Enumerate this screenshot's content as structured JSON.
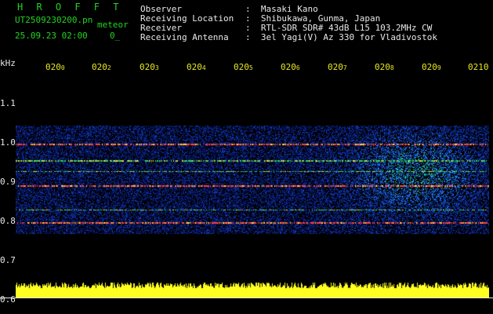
{
  "header": {
    "brand": "H R O F F T",
    "filename": "UT2509230200.pn",
    "mode": "meteor",
    "datetime": "25.09.23 02:00",
    "counter": "0_",
    "info": [
      {
        "label": "Observer",
        "value": ":  Masaki Kano"
      },
      {
        "label": "Receiving Location",
        "value": ":  Shibukawa, Gunma, Japan"
      },
      {
        "label": "Receiver",
        "value": ":  RTL-SDR SDR# 43dB L15 103.2MHz CW"
      },
      {
        "label": "Receiving Antenna",
        "value": ":  3el Yagi(V) Az 330 for Vladivostok"
      }
    ]
  },
  "axis": {
    "y_unit": "kHz",
    "y_ticks": [
      "1.1",
      "1.0",
      "0.9",
      "0.8",
      "0.7",
      "0.6"
    ],
    "x_ticks": [
      "020",
      "020",
      "020",
      "020",
      "020",
      "020",
      "020",
      "020",
      "020",
      "0210"
    ],
    "x_ticks_suffix": [
      "0",
      "2",
      "3",
      "4",
      "5",
      "6",
      "7",
      "8",
      "9",
      ""
    ]
  },
  "colors": {
    "text_green": "#22d422",
    "text_white": "#e8e8e8",
    "text_yellow": "#e8e820",
    "signal_bar": "#ffff20"
  }
}
